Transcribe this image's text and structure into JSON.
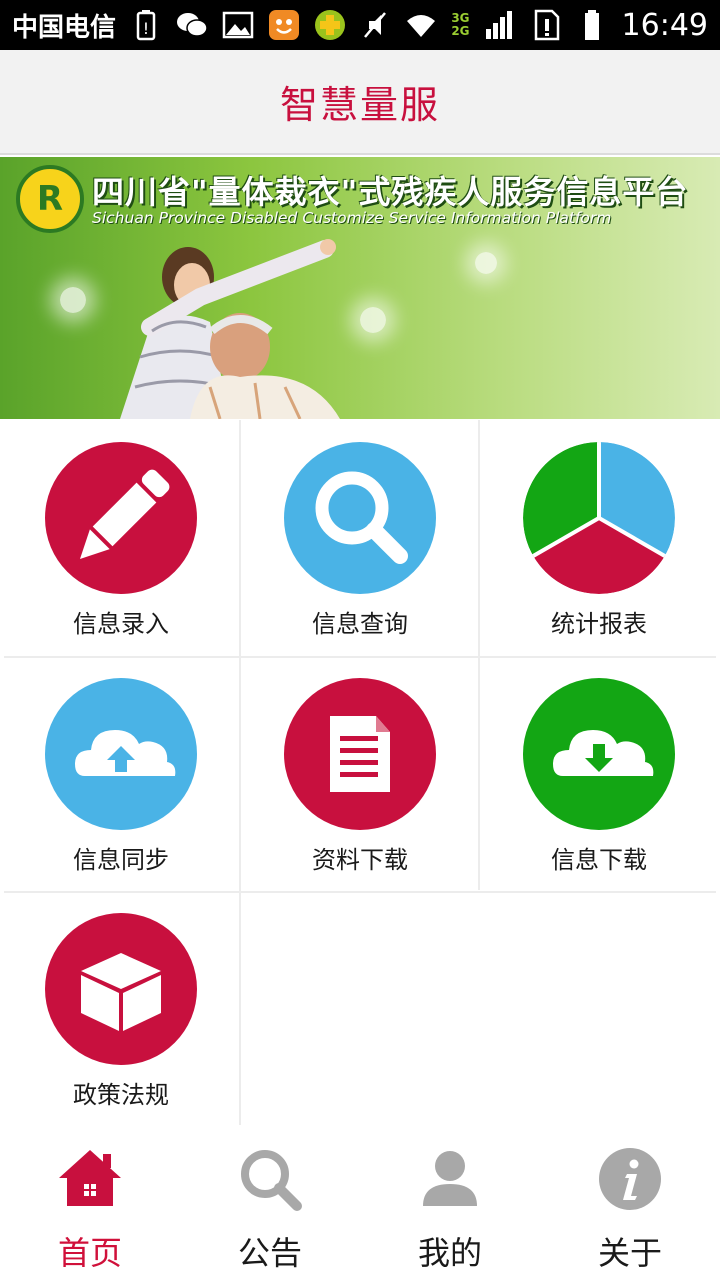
{
  "status_bar": {
    "carrier": "中国电信",
    "network": [
      "3G",
      "2G"
    ],
    "time": "16:49"
  },
  "header": {
    "title": "智慧量服"
  },
  "banner": {
    "title_cn": "四川省\"量体裁衣\"式残疾人服务信息平台",
    "title_en": "Sichuan Province Disabled Customize Service Information Platform"
  },
  "colors": {
    "accent": "#c8103e",
    "blue": "#4ab3e6",
    "green": "#13a614",
    "tab_inactive": "#a8a8a8"
  },
  "menu": [
    {
      "label": "信息录入",
      "icon": "pencil-icon"
    },
    {
      "label": "信息查询",
      "icon": "search-icon"
    },
    {
      "label": "统计报表",
      "icon": "pie-chart-icon"
    },
    {
      "label": "信息同步",
      "icon": "cloud-upload-icon"
    },
    {
      "label": "资料下载",
      "icon": "document-icon"
    },
    {
      "label": "信息下载",
      "icon": "cloud-download-icon"
    },
    {
      "label": "政策法规",
      "icon": "box-icon"
    }
  ],
  "tabs": [
    {
      "label": "首页",
      "icon": "home-icon",
      "active": true
    },
    {
      "label": "公告",
      "icon": "search-icon",
      "active": false
    },
    {
      "label": "我的",
      "icon": "user-icon",
      "active": false
    },
    {
      "label": "关于",
      "icon": "info-icon",
      "active": false
    }
  ]
}
